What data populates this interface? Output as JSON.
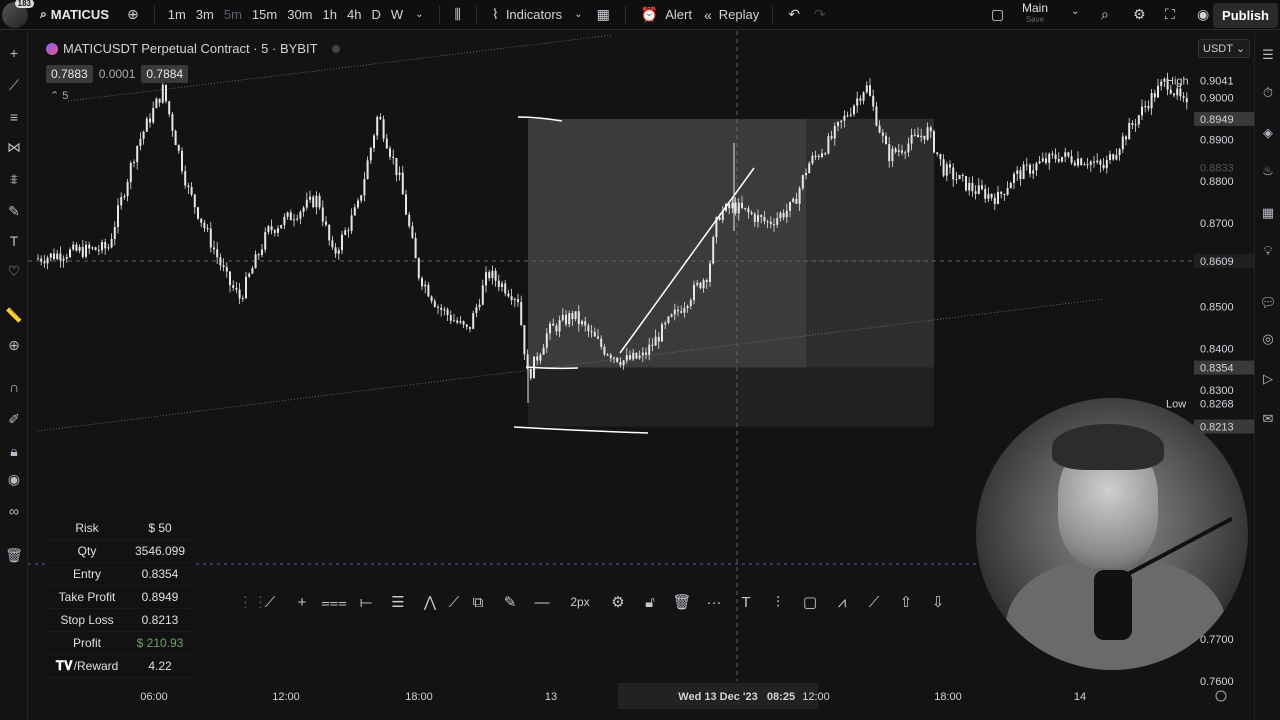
{
  "topbar": {
    "avatar_badge": "183",
    "symbol": "MATICUS",
    "intervals": [
      "1m",
      "3m",
      "5m",
      "15m",
      "30m",
      "1h",
      "4h",
      "D",
      "W"
    ],
    "active_interval": "5m",
    "indicators_label": "Indicators",
    "alert_label": "Alert",
    "replay_label": "Replay",
    "layout_name": "Main",
    "layout_sub": "Save",
    "publish_label": "Publish"
  },
  "chart": {
    "title": "MATICUSDT Perpetual Contract · 5 · BYBIT",
    "bid": "0.7883",
    "spread": "0.0001",
    "ask": "0.7884",
    "collapse_count": "5",
    "currency": "USDT",
    "price_labels": [
      {
        "text": "0.9041",
        "tag": "High",
        "value": 0.9041,
        "highlight": false
      },
      {
        "text": "0.9000",
        "value": 0.9
      },
      {
        "text": "0.8949",
        "value": 0.8949,
        "highlight": true
      },
      {
        "text": "0.8900",
        "value": 0.89
      },
      {
        "text": "0.8833",
        "value": 0.8833,
        "muted": true
      },
      {
        "text": "0.8800",
        "value": 0.88
      },
      {
        "text": "0.8700",
        "value": 0.87
      },
      {
        "text": "0.8609",
        "value": 0.8609,
        "crosshair": true
      },
      {
        "text": "0.8500",
        "value": 0.85
      },
      {
        "text": "0.8400",
        "value": 0.84
      },
      {
        "text": "0.8354",
        "value": 0.8354,
        "highlight": true
      },
      {
        "text": "0.8300",
        "value": 0.83
      },
      {
        "text": "0.8268",
        "tag": "Low",
        "value": 0.8268
      },
      {
        "text": "0.8213",
        "value": 0.8213,
        "highlight": true
      },
      {
        "text": "0.7700",
        "value": 0.77
      },
      {
        "text": "0.7600",
        "value": 0.76
      }
    ],
    "time_labels": [
      "06:00",
      "12:00",
      "18:00",
      "13",
      "Wed 13 Dec '23",
      "08:25",
      "12:00",
      "18:00",
      "14"
    ]
  },
  "position": {
    "rows": [
      {
        "k": "Risk",
        "v": "$ 50"
      },
      {
        "k": "Qty",
        "v": "3546.099"
      },
      {
        "k": "Entry",
        "v": "0.8354"
      },
      {
        "k": "Take Profit",
        "v": "0.8949"
      },
      {
        "k": "Stop Loss",
        "v": "0.8213"
      },
      {
        "k": "Profit",
        "v": "$ 210.93",
        "green": true
      },
      {
        "k": "/Reward",
        "v": "4.22",
        "logo": true
      }
    ]
  },
  "draw_toolbar": {
    "width_label": "2px"
  },
  "colors": {
    "background": "#131313",
    "candles": "#e6e6e6",
    "profit_zone": "#4a4a4a",
    "stop_zone": "#2a2a2a",
    "profit_text": "#6fa26b"
  }
}
